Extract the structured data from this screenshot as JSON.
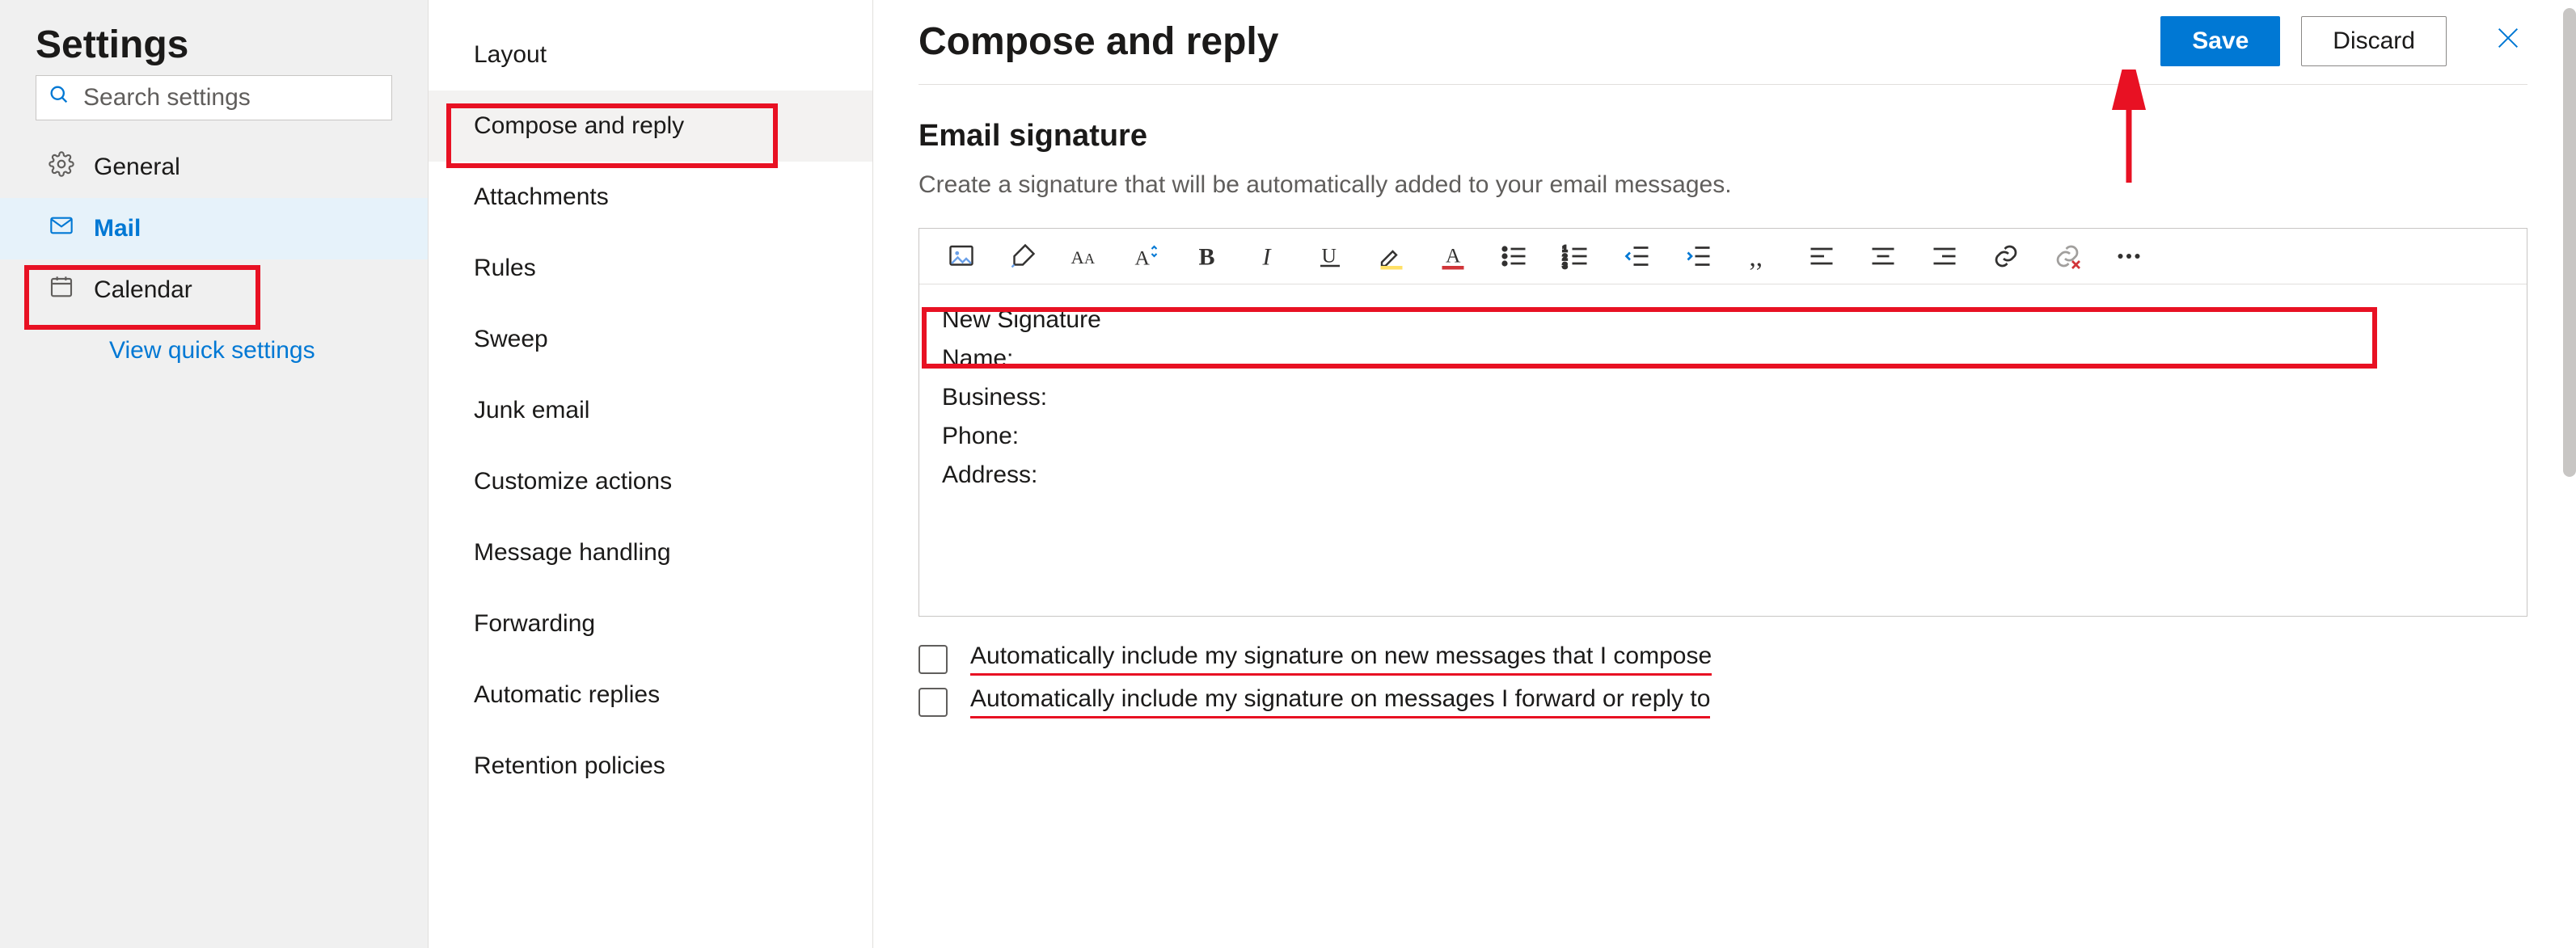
{
  "sidebar": {
    "title": "Settings",
    "search_placeholder": "Search settings",
    "items": [
      {
        "id": "general",
        "icon": "gear-icon",
        "label": "General"
      },
      {
        "id": "mail",
        "icon": "mail-icon",
        "label": "Mail"
      },
      {
        "id": "calendar",
        "icon": "calendar-icon",
        "label": "Calendar"
      }
    ],
    "active_id": "mail",
    "quick_link_label": "View quick settings"
  },
  "subnav": {
    "items": [
      "Layout",
      "Compose and reply",
      "Attachments",
      "Rules",
      "Sweep",
      "Junk email",
      "Customize actions",
      "Message handling",
      "Forwarding",
      "Automatic replies",
      "Retention policies"
    ],
    "active_index": 1
  },
  "header": {
    "title": "Compose and reply",
    "save_label": "Save",
    "discard_label": "Discard"
  },
  "section": {
    "title": "Email signature",
    "description": "Create a signature that will be automatically added to your email messages."
  },
  "toolbar": {
    "buttons": [
      "insert-image-icon",
      "format-painter-icon",
      "font-name-icon",
      "font-size-icon",
      "bold-icon",
      "italic-icon",
      "underline-icon",
      "highlight-icon",
      "font-color-icon",
      "bullet-list-icon",
      "number-list-icon",
      "outdent-icon",
      "indent-icon",
      "quote-icon",
      "align-left-icon",
      "align-center-icon",
      "align-right-icon",
      "insert-link-icon",
      "remove-link-icon",
      "more-options-icon"
    ]
  },
  "signature_lines": [
    "New Signature",
    "Name:",
    "Business:",
    "Phone:",
    "Address:"
  ],
  "checkboxes": {
    "include_new": "Automatically include my signature on new messages that I compose",
    "include_reply": "Automatically include my signature on messages I forward or reply to"
  },
  "annotations": {
    "mail_highlight": true,
    "subnav_highlight": true,
    "toolbar_highlight": true,
    "save_arrow": true
  },
  "colors": {
    "primary": "#0078d4",
    "annotation": "#e81123"
  }
}
